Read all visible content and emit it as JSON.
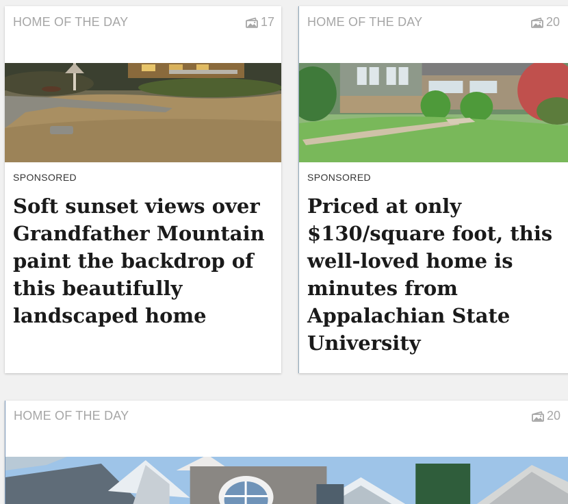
{
  "cards": [
    {
      "kicker": "HOME OF THE DAY",
      "photo_icon": "gallery-icon",
      "photo_count": "17",
      "sponsored_label": "SPONSORED",
      "headline": "Soft sunset views over Grandfather Mountain paint the backdrop of this beautifully landscaped home"
    },
    {
      "kicker": "HOME OF THE DAY",
      "photo_icon": "gallery-icon",
      "photo_count": "20",
      "sponsored_label": "SPONSORED",
      "headline": "Priced at only $130/square foot, this well-loved home is minutes from Appalachian State University"
    },
    {
      "kicker": "HOME OF THE DAY",
      "photo_icon": "gallery-icon",
      "photo_count": "20"
    }
  ],
  "colors": {
    "page_background": "#f1f1f1",
    "card_background": "#ffffff",
    "kicker_text": "#a6a6a6",
    "headline_text": "#1a1a1a"
  }
}
